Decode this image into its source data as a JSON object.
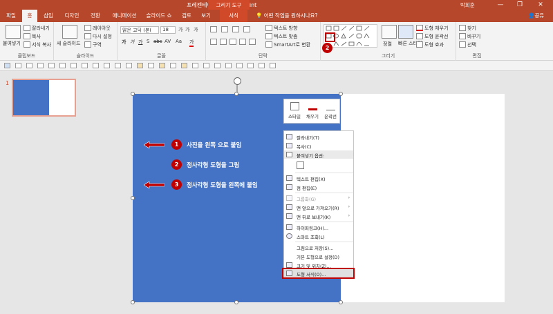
{
  "titlebar": {
    "title": "프레젠테이션3 - PowerPoint",
    "context_tools": "그리기 도구",
    "user": "박희훈",
    "minimize": "—",
    "restore": "❐",
    "close": "✕"
  },
  "tabs": [
    "파일",
    "홈",
    "삽입",
    "디자인",
    "전환",
    "애니메이션",
    "슬라이드 쇼",
    "검토",
    "보기",
    "서식"
  ],
  "tellme": "어떤 작업을 원하시나요?",
  "share": "공유",
  "ribbon": {
    "clipboard": {
      "paste": "붙여넣기",
      "cut": "잘라내기",
      "copy": "복사",
      "format_painter": "서식 복사",
      "label": "클립보드"
    },
    "slides": {
      "new_slide": "새 슬라이드",
      "layout": "레이아웃",
      "reset": "다시 설정",
      "section": "구역",
      "label": "슬라이드"
    },
    "font": {
      "font_name": "맑은 고딕 (본(",
      "font_size": "18",
      "bold": "가",
      "italic": "가",
      "underline": "가",
      "shadow": "S",
      "strike": "abc",
      "spacing": "AV",
      "case": "Aa",
      "color": "가",
      "grow": "가",
      "shrink": "가",
      "clear": "가",
      "label": "글꼴"
    },
    "paragraph": {
      "text_direction": "텍스트 방향",
      "align_text": "텍스트 맞춤",
      "smartart": "SmartArt로 변환",
      "label": "단락"
    },
    "drawing": {
      "arrange": "정렬",
      "quick_styles": "빠른\n스타일",
      "shape_fill": "도형 채우기",
      "shape_outline": "도형 윤곽선",
      "shape_effects": "도형 효과",
      "label": "그리기"
    },
    "editing": {
      "find": "찾기",
      "replace": "바꾸기",
      "select": "선택",
      "label": "편집"
    }
  },
  "slide_panel": {
    "slide_number": "1"
  },
  "steps": [
    {
      "num": "1",
      "text": "사진을 왼쪽 으로 붙임"
    },
    {
      "num": "2",
      "text": "정사각형 도형을 그림"
    },
    {
      "num": "3",
      "text": "정사각형 도형을 왼쪽에 붙임"
    }
  ],
  "badge2": "2",
  "mini_toolbar": {
    "style": "스타일",
    "fill": "채우기",
    "outline": "윤곽선"
  },
  "context_menu": {
    "cut": "잘라내기(T)",
    "copy": "복사(C)",
    "paste_options": "붙여넣기 옵션:",
    "edit_text": "텍스트 편집(X)",
    "edit_points": "점 편집(E)",
    "group": "그룹화(G)",
    "bring_front": "맨 앞으로 가져오기(R)",
    "send_back": "맨 뒤로 보내기(K)",
    "hyperlink": "하이퍼링크(H)...",
    "smart_lookup": "스마트 조회(L)",
    "save_picture": "그림으로 저장(S)...",
    "set_default": "기본 도형으로 설정(D)",
    "size_position": "크기 및 위치(Z)...",
    "format_shape": "도형 서식(O)...",
    "submenu_arrow": "›"
  },
  "colors": {
    "ppt_red": "#b7472a",
    "shape_blue": "#4472c4",
    "callout_red": "#c00000"
  }
}
